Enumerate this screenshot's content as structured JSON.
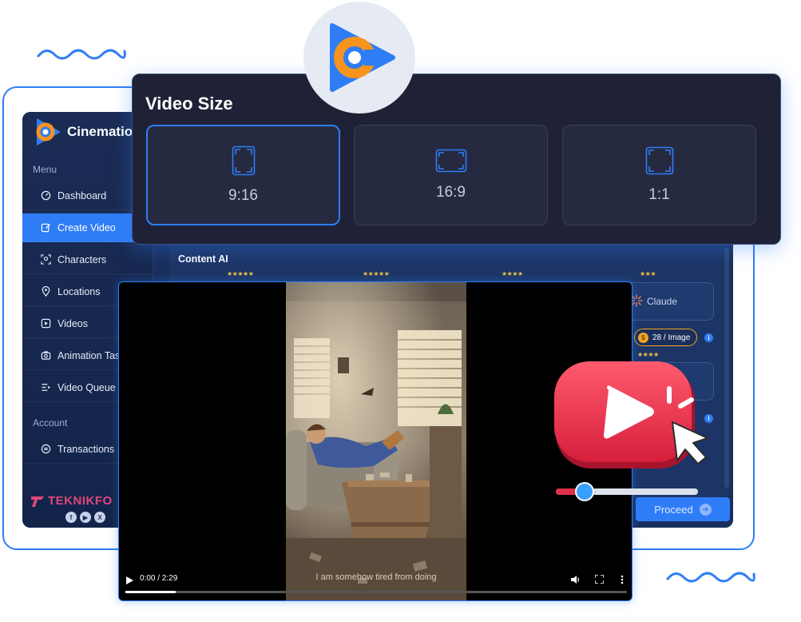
{
  "app": {
    "brand_name": "Cinematio",
    "menu_label": "Menu",
    "account_label": "Account",
    "nav": [
      {
        "label": "Dashboard",
        "icon": "gauge-icon"
      },
      {
        "label": "Create Video",
        "icon": "edit-icon",
        "active": true
      },
      {
        "label": "Characters",
        "icon": "face-scan-icon"
      },
      {
        "label": "Locations",
        "icon": "location-pin-icon"
      },
      {
        "label": "Videos",
        "icon": "video-file-icon"
      },
      {
        "label": "Animation Tasks",
        "icon": "camera-icon"
      },
      {
        "label": "Video Queue",
        "icon": "queue-icon"
      }
    ],
    "account_nav": [
      {
        "label": "Transactions",
        "icon": "transactions-icon"
      }
    ],
    "watermark": "TEKNIKFO",
    "socials": [
      "f",
      "▶",
      "X"
    ]
  },
  "main": {
    "content_ai_label": "Content AI",
    "star_ratings": [
      "★★★★★",
      "★★★★★",
      "★★★★",
      "★★★",
      "★★★★"
    ],
    "claude_label": "Claude",
    "price_label": "28 / Image",
    "proceed_label": "Proceed"
  },
  "video_size": {
    "title": "Video Size",
    "options": [
      {
        "label": "9:16",
        "selected": true
      },
      {
        "label": "16:9",
        "selected": false
      },
      {
        "label": "1:1",
        "selected": false
      }
    ]
  },
  "player": {
    "time_label": "0:00 / 2:29",
    "subtitle": "I am somehow tired from doing",
    "progress": 0.1
  },
  "volume_slider": {
    "value": 0.2
  },
  "colors": {
    "accent": "#2f7df6",
    "panel": "#1f2236",
    "logo_orange": "#f7941d",
    "play_red": "#e0304a"
  }
}
